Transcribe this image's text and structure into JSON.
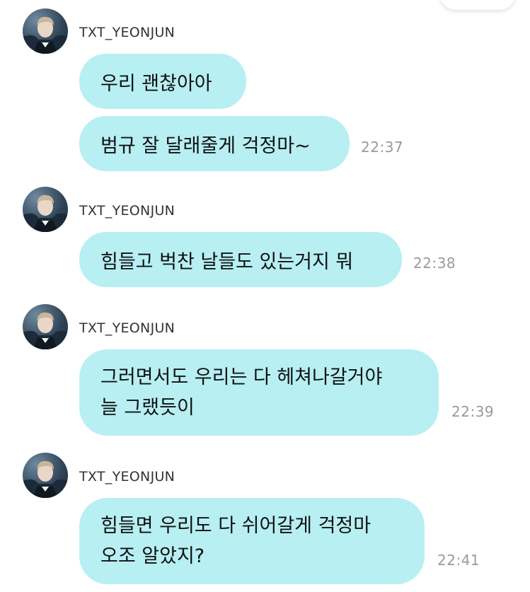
{
  "messages": [
    {
      "sender": "TXT_YEONJUN",
      "bubbles": [
        {
          "lines": [
            "우리 괜찮아아"
          ],
          "time": ""
        },
        {
          "lines": [
            "범규 잘 달래줄게 걱정마~"
          ],
          "time": "22:37"
        }
      ]
    },
    {
      "sender": "TXT_YEONJUN",
      "bubbles": [
        {
          "lines": [
            "힘들고 벅찬 날들도 있는거지 뭐"
          ],
          "time": "22:38"
        }
      ]
    },
    {
      "sender": "TXT_YEONJUN",
      "bubbles": [
        {
          "lines": [
            "그러면서도 우리는 다 헤쳐나갈거야",
            "늘 그랬듯이"
          ],
          "time": "22:39"
        }
      ]
    },
    {
      "sender": "TXT_YEONJUN",
      "bubbles": [
        {
          "lines": [
            "힘들면 우리도 다 쉬어갈게 걱정마",
            "오조 알았지?"
          ],
          "time": "22:41"
        }
      ]
    }
  ],
  "colors": {
    "bubble": "#b7eff3",
    "sender_text": "#333333",
    "time_text": "#9a9a9a"
  },
  "icons": {
    "avatar": "profile-photo"
  }
}
